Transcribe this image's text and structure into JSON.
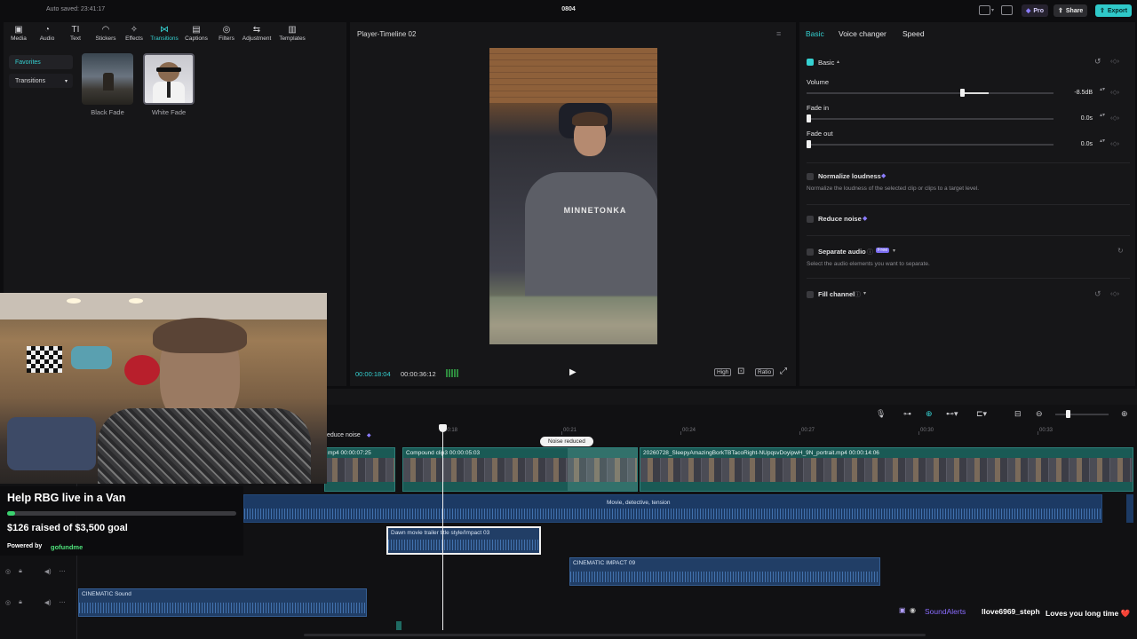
{
  "topbar": {
    "autosave": "Auto saved: 23:41:17",
    "project_name": "0804",
    "pro_label": "Pro",
    "share_label": "Share",
    "export_label": "Export"
  },
  "media": {
    "tools": [
      {
        "label": "Media",
        "icon": "▣"
      },
      {
        "label": "Audio",
        "icon": "◔"
      },
      {
        "label": "Text",
        "icon": "TI"
      },
      {
        "label": "Stickers",
        "icon": "◠"
      },
      {
        "label": "Effects",
        "icon": "✧"
      },
      {
        "label": "Transitions",
        "icon": "⋈"
      },
      {
        "label": "Captions",
        "icon": "▤"
      },
      {
        "label": "Filters",
        "icon": "◎"
      },
      {
        "label": "Adjustment",
        "icon": "⇆"
      },
      {
        "label": "Templates",
        "icon": "▥"
      }
    ],
    "favorites_label": "Favorites",
    "transitions_dropdown": "Transitions",
    "items": [
      "Black Fade",
      "White Fade"
    ]
  },
  "player": {
    "title": "Player-Timeline 02",
    "current_time": "00:00:18:04",
    "total_time": "00:00:36:12",
    "quality_label": "High",
    "ratio_label": "Ratio"
  },
  "inspector": {
    "tabs": [
      "Basic",
      "Voice changer",
      "Speed"
    ],
    "section": "Basic",
    "volume": {
      "label": "Volume",
      "value": "-8.5dB",
      "level": 0.63
    },
    "fade_in": {
      "label": "Fade in",
      "value": "0.0s"
    },
    "fade_out": {
      "label": "Fade out",
      "value": "0.0s"
    },
    "normalize": {
      "label": "Normalize loudness",
      "desc": "Normalize the loudness of the selected clip or clips to a target level."
    },
    "reduce_noise": {
      "label": "Reduce noise"
    },
    "separate_audio": {
      "label": "Separate audio",
      "badge": "Free",
      "desc": "Select the audio elements you want to separate."
    },
    "fill_channel": {
      "label": "Fill channel"
    }
  },
  "timeline": {
    "ruler": [
      "00:18",
      "00:21",
      "00:24",
      "00:27",
      "00:30",
      "00:33"
    ],
    "reduce_noise_label": "educe noise",
    "noise_tooltip": "Noise reduced",
    "clips_video": [
      {
        "name": "mp4  00:00:07:25"
      },
      {
        "name": "Compound clip3  00:00:05:03"
      },
      {
        "name": "20260728_SleepyAmazingBorkTBTacoRight-NUpqsvDoyipwH_9N_portrait.mp4  00:00:14:06"
      }
    ],
    "music_label": "Movie, detective, tension",
    "audio_clips": [
      {
        "name": "Dawn movie trailer title style/Impact 03"
      },
      {
        "name": "CINEMATIC IMPACT 09"
      },
      {
        "name": "CINEMATIC Sound"
      }
    ]
  },
  "overlay": {
    "donation_title": "Help RBG live in a Van",
    "donation_progress": "$126 raised of $3,500 goal",
    "donation_fraction": 0.036,
    "powered_by": "Powered by",
    "gofundme": "gofundme",
    "chat_source": "SoundAlerts",
    "chat_user": "llove6969_steph",
    "chat_message": "Loves you long time ❤️"
  },
  "colors": {
    "accent": "#35d1d1",
    "export": "#2fc9c9",
    "pro": "#7a6cf0"
  }
}
